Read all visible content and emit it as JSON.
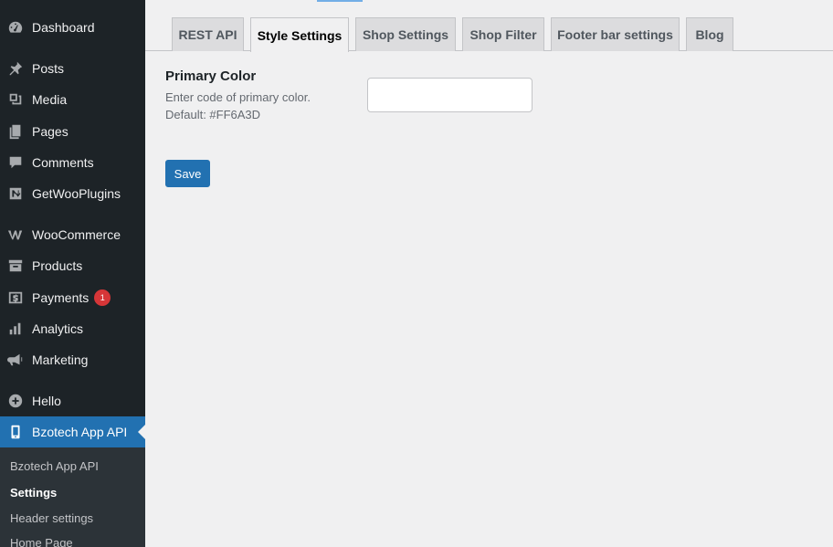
{
  "sidebar": {
    "items": [
      {
        "label": "Dashboard",
        "icon": "dashboard-icon"
      },
      {
        "label": "Posts",
        "icon": "pin-icon"
      },
      {
        "label": "Media",
        "icon": "media-icon"
      },
      {
        "label": "Pages",
        "icon": "pages-icon"
      },
      {
        "label": "Comments",
        "icon": "comment-icon"
      },
      {
        "label": "GetWooPlugins",
        "icon": "plugin-icon"
      },
      {
        "label": "WooCommerce",
        "icon": "woocommerce-icon"
      },
      {
        "label": "Products",
        "icon": "archive-icon"
      },
      {
        "label": "Payments",
        "icon": "payments-icon",
        "badge": "1"
      },
      {
        "label": "Analytics",
        "icon": "bar-chart-icon"
      },
      {
        "label": "Marketing",
        "icon": "megaphone-icon"
      },
      {
        "label": "Hello",
        "icon": "plus-circle-icon"
      },
      {
        "label": "Bzotech App API",
        "icon": "phone-icon"
      }
    ],
    "submenu": [
      {
        "label": "Bzotech App API"
      },
      {
        "label": "Settings"
      },
      {
        "label": "Header settings"
      },
      {
        "label": "Home Page"
      }
    ]
  },
  "tabs": [
    {
      "label": "REST API"
    },
    {
      "label": "Style Settings"
    },
    {
      "label": "Shop Settings"
    },
    {
      "label": "Shop Filter"
    },
    {
      "label": "Footer bar settings"
    },
    {
      "label": "Blog"
    }
  ],
  "active_tab": "Style Settings",
  "form": {
    "primary_color": {
      "label": "Primary Color",
      "desc_line1": "Enter code of primary color.",
      "desc_line2": "Default: #FF6A3D",
      "value": ""
    },
    "save_label": "Save"
  },
  "colors": {
    "sidebar_bg": "#1d2327",
    "accent": "#2271b1",
    "badge": "#d63638",
    "page_bg": "#f0f0f1"
  }
}
